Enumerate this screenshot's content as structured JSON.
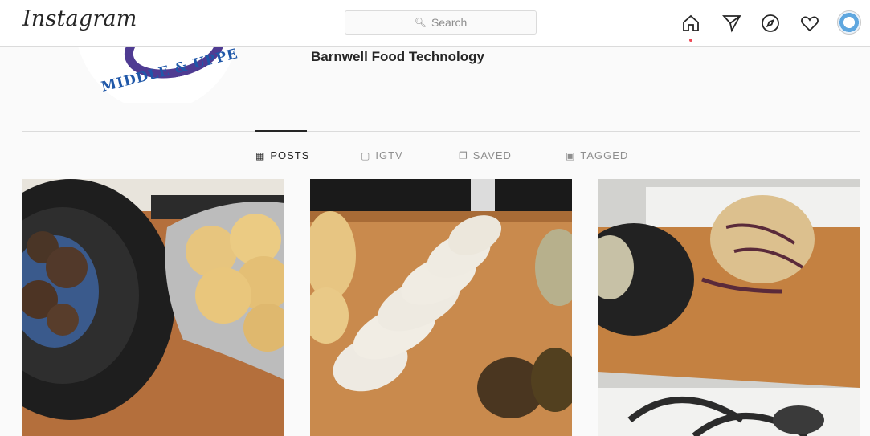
{
  "header": {
    "logo": "Instagram",
    "search_placeholder": "Search",
    "icons": [
      "home-icon",
      "direct-message-icon",
      "explore-icon",
      "activity-heart-icon",
      "profile-avatar"
    ],
    "notification_color": "#ed4956"
  },
  "profile": {
    "logo_text": "MIDDLE & UPPE",
    "username": "Barnwell Food Technology"
  },
  "tabs": [
    {
      "label": "POSTS",
      "icon": "grid-icon",
      "active": true
    },
    {
      "label": "IGTV",
      "icon": "igtv-icon",
      "active": false
    },
    {
      "label": "SAVED",
      "icon": "bookmark-icon",
      "active": false
    },
    {
      "label": "TAGGED",
      "icon": "tagged-icon",
      "active": false
    }
  ],
  "posts": [
    {
      "subject": "bread rolls in foil next to pan"
    },
    {
      "subject": "sliced loaf on wooden board"
    },
    {
      "subject": "loaf with onions on board over stove"
    }
  ]
}
